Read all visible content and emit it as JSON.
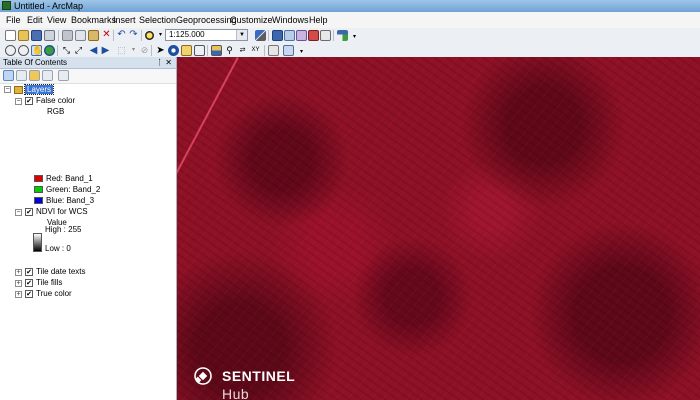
{
  "window": {
    "title": "Untitled - ArcMap"
  },
  "menu": [
    "File",
    "Edit",
    "View",
    "Bookmarks",
    "Insert",
    "Selection",
    "Geoprocessing",
    "Customize",
    "Windows",
    "Help"
  ],
  "toolbar": {
    "scale": "1:125.000"
  },
  "toc": {
    "title": "Table Of Contents",
    "root": "Layers",
    "false_color": {
      "name": "False color",
      "legend_title": "RGB",
      "bands": [
        {
          "label": "Red:",
          "value": "Band_1",
          "color": "#e00000"
        },
        {
          "label": "Green:",
          "value": "Band_2",
          "color": "#00d000"
        },
        {
          "label": "Blue:",
          "value": "Band_3",
          "color": "#0000d8"
        }
      ]
    },
    "ndvi": {
      "name": "NDVI for WCS",
      "value_title": "Value",
      "high": "High : 255",
      "low": "Low : 0"
    },
    "other_layers": [
      "Tile date texts",
      "Tile fills",
      "True color"
    ]
  },
  "map": {
    "logo_main": "SENTINEL",
    "logo_sub": "Hub"
  }
}
